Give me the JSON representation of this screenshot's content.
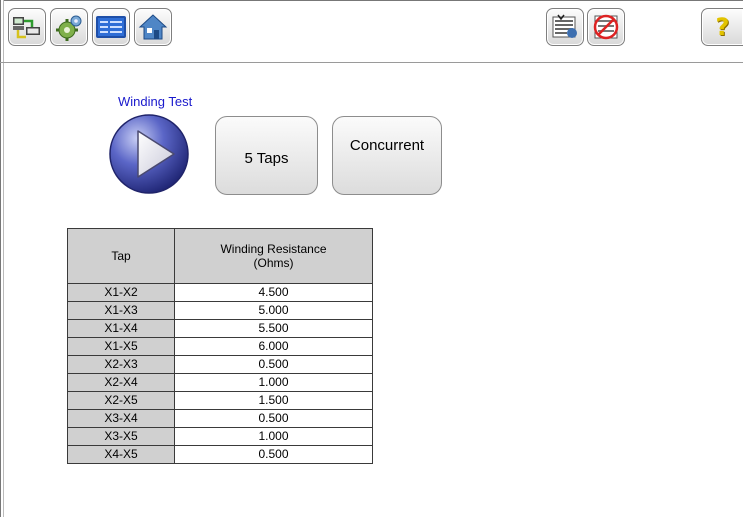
{
  "toolbar": {
    "left_icons": [
      "connection-icon",
      "settings-icon",
      "display-icon",
      "home-icon"
    ],
    "right_icons": [
      "report-icon",
      "clear-icon",
      "help-icon"
    ],
    "help_glyph": "?"
  },
  "test": {
    "title": "Winding Test",
    "taps_button": "5 Taps",
    "concurrent_button": "Concurrent"
  },
  "table": {
    "header_tap": "Tap",
    "header_resistance_line1": "Winding Resistance",
    "header_resistance_line2": "(Ohms)",
    "rows": [
      {
        "tap": "X1-X2",
        "value": "4.500"
      },
      {
        "tap": "X1-X3",
        "value": "5.000"
      },
      {
        "tap": "X1-X4",
        "value": "5.500"
      },
      {
        "tap": "X1-X5",
        "value": "6.000"
      },
      {
        "tap": "X2-X3",
        "value": "0.500"
      },
      {
        "tap": "X2-X4",
        "value": "1.000"
      },
      {
        "tap": "X2-X5",
        "value": "1.500"
      },
      {
        "tap": "X3-X4",
        "value": "0.500"
      },
      {
        "tap": "X3-X5",
        "value": "1.000"
      },
      {
        "tap": "X4-X5",
        "value": "0.500"
      }
    ]
  },
  "colors": {
    "title_blue": "#1a1acc",
    "play_blue": "#3a43a8",
    "header_gray": "#d0d0d0"
  }
}
